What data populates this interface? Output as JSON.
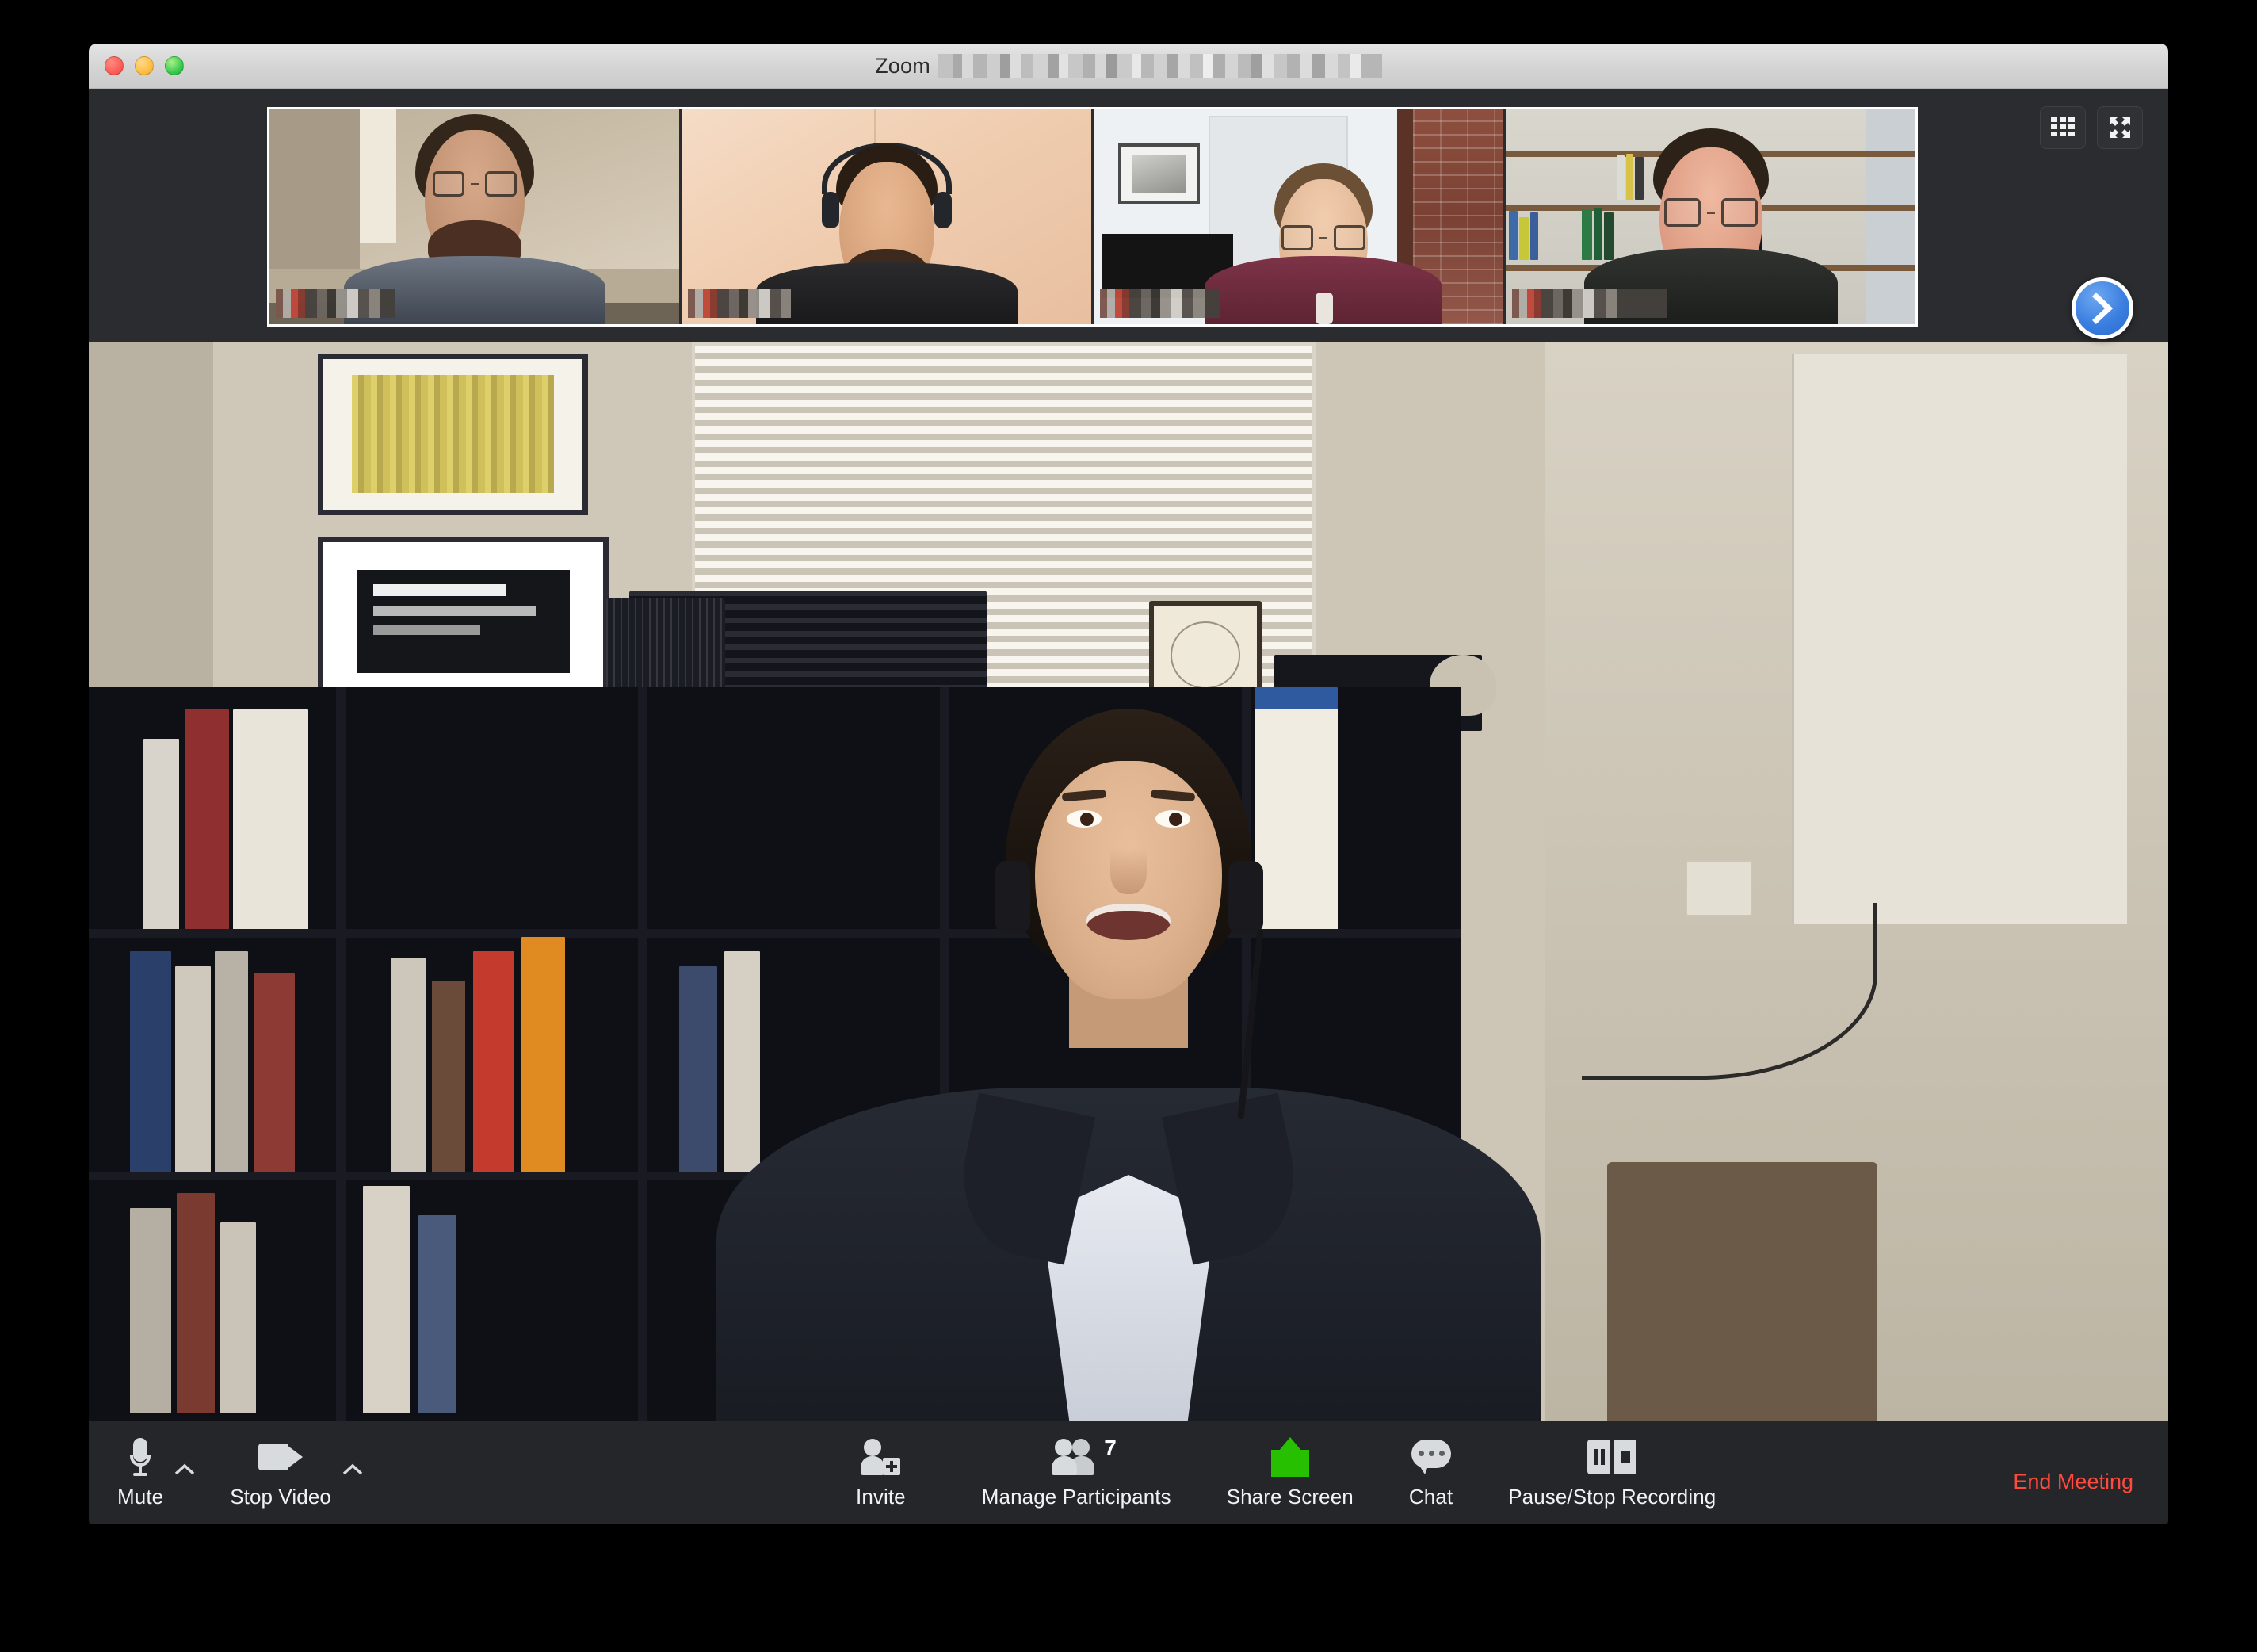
{
  "app": {
    "name": "Zoom",
    "title_prefix": "Zoom",
    "title_redacted": true
  },
  "window": {
    "controls": {
      "close": "close-button",
      "minimize": "minimize-button",
      "zoom": "maximize-button"
    }
  },
  "view_controls": {
    "gallery_view": "gallery-view-icon",
    "fullscreen": "fullscreen-icon"
  },
  "filmstrip": {
    "next_page": "chevron-right-icon",
    "thumbnails": [
      {
        "name_label": "redacted",
        "description": "participant-1"
      },
      {
        "name_label": "redacted",
        "description": "participant-2"
      },
      {
        "name_label": "redacted",
        "description": "participant-3"
      },
      {
        "name_label": "redacted",
        "description": "participant-4"
      }
    ]
  },
  "main_video": {
    "description": "active-speaker"
  },
  "toolbar": {
    "mute": {
      "label": "Mute",
      "icon": "microphone-icon",
      "caret": "chevron-up-icon"
    },
    "video": {
      "label": "Stop Video",
      "icon": "camera-icon",
      "caret": "chevron-up-icon"
    },
    "invite": {
      "label": "Invite",
      "icon": "person-add-icon"
    },
    "participants": {
      "label": "Manage Participants",
      "icon": "people-icon",
      "count": "7"
    },
    "share": {
      "label": "Share Screen",
      "icon": "share-screen-icon",
      "color": "#26c000"
    },
    "chat": {
      "label": "Chat",
      "icon": "chat-bubble-icon"
    },
    "record": {
      "label": "Pause/Stop Recording",
      "icon": "pause-stop-icon"
    },
    "end": {
      "label": "End Meeting",
      "color": "#ff4a3d"
    }
  }
}
